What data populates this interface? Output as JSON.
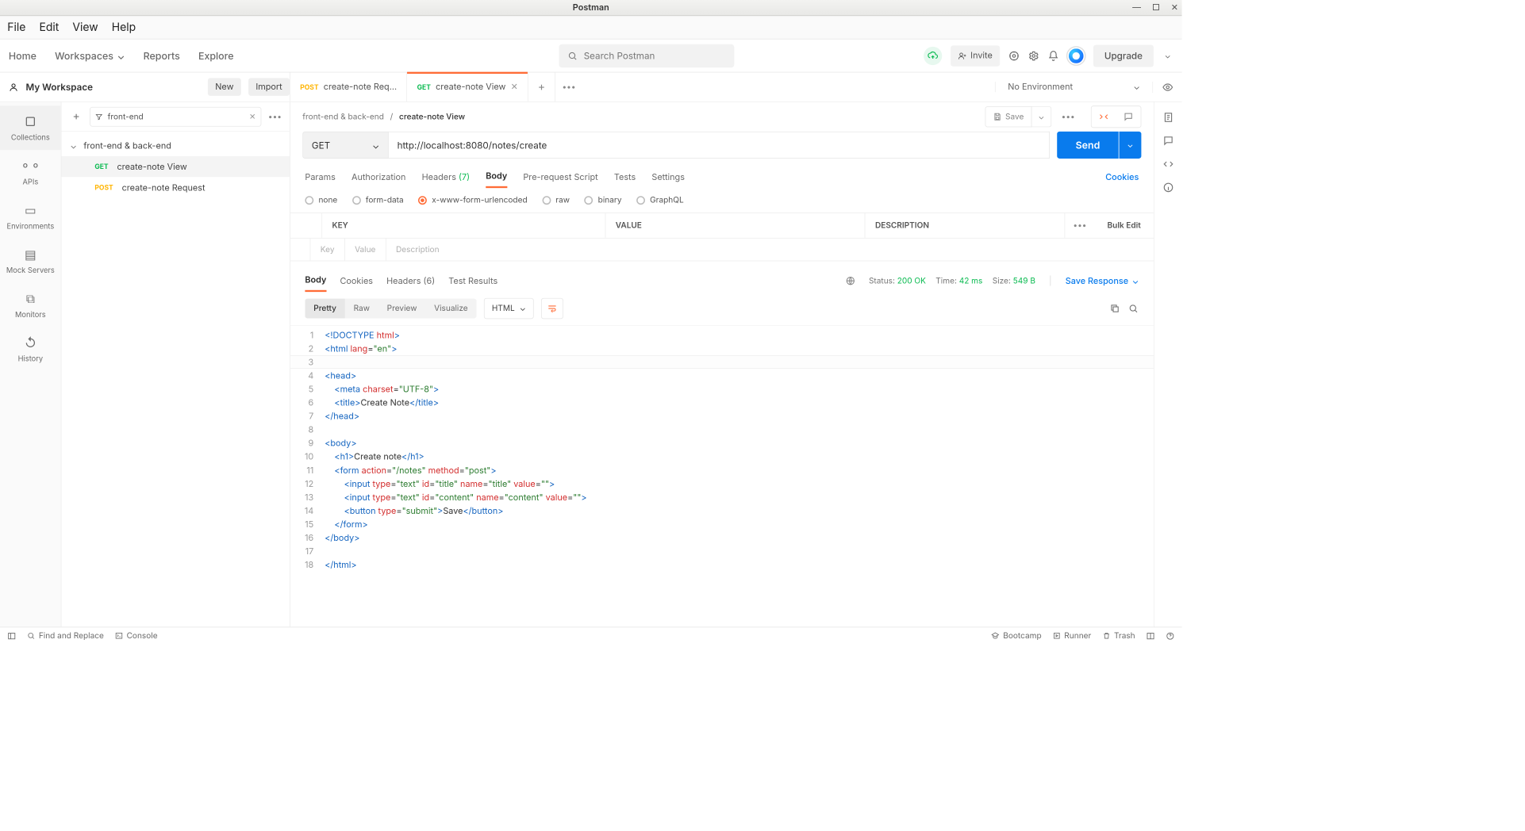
{
  "window": {
    "title": "Postman"
  },
  "menubar": [
    "File",
    "Edit",
    "View",
    "Help"
  ],
  "nav": {
    "home": "Home",
    "workspaces": "Workspaces",
    "reports": "Reports",
    "explore": "Explore",
    "search_placeholder": "Search Postman",
    "invite": "Invite",
    "upgrade": "Upgrade"
  },
  "workspace": {
    "name": "My Workspace",
    "new": "New",
    "import": "Import",
    "tabs": [
      {
        "method": "POST",
        "label": "create-note Req…",
        "active": false
      },
      {
        "method": "GET",
        "label": "create-note View",
        "active": true
      }
    ],
    "env": "No Environment"
  },
  "rail": [
    {
      "id": "collections",
      "label": "Collections"
    },
    {
      "id": "apis",
      "label": "APIs"
    },
    {
      "id": "environments",
      "label": "Environments"
    },
    {
      "id": "mock",
      "label": "Mock Servers"
    },
    {
      "id": "monitors",
      "label": "Monitors"
    },
    {
      "id": "history",
      "label": "History"
    }
  ],
  "sidebar": {
    "filter": "front-end",
    "collection": "front-end & back-end",
    "items": [
      {
        "method": "GET",
        "label": "create-note View",
        "selected": true
      },
      {
        "method": "POST",
        "label": "create-note Request",
        "selected": false
      }
    ]
  },
  "breadcrumb": {
    "parent": "front-end & back-end",
    "current": "create-note View",
    "save": "Save"
  },
  "request": {
    "method": "GET",
    "url": "http://localhost:8080/notes/create",
    "send": "Send",
    "tabs": {
      "params": "Params",
      "auth": "Authorization",
      "headers": "Headers",
      "headers_count": "(7)",
      "body": "Body",
      "prereq": "Pre-request Script",
      "tests": "Tests",
      "settings": "Settings",
      "cookies": "Cookies"
    },
    "body_types": {
      "none": "none",
      "form": "form-data",
      "xwww": "x-www-form-urlencoded",
      "raw": "raw",
      "binary": "binary",
      "graphql": "GraphQL"
    },
    "kv": {
      "key": "KEY",
      "value": "VALUE",
      "desc": "DESCRIPTION",
      "bulk": "Bulk Edit",
      "key_ph": "Key",
      "value_ph": "Value",
      "desc_ph": "Description"
    }
  },
  "response": {
    "tabs": {
      "body": "Body",
      "cookies": "Cookies",
      "headers": "Headers",
      "headers_count": "(6)",
      "tests": "Test Results"
    },
    "status_label": "Status:",
    "status_value": "200 OK",
    "time_label": "Time:",
    "time_value": "42 ms",
    "size_label": "Size:",
    "size_value": "549 B",
    "save": "Save Response",
    "views": {
      "pretty": "Pretty",
      "raw": "Raw",
      "preview": "Preview",
      "visualize": "Visualize"
    },
    "lang": "HTML",
    "code_lines": [
      {
        "n": 1,
        "html": "<span class='tag'>&lt;!DOCTYPE</span> <span class='attr'>html</span><span class='tag'>&gt;</span>"
      },
      {
        "n": 2,
        "html": "<span class='tag'>&lt;html</span> <span class='attr'>lang</span>=<span class='str'>\"en\"</span><span class='tag'>&gt;</span>"
      },
      {
        "n": 3,
        "html": ""
      },
      {
        "n": 4,
        "html": "<span class='tag'>&lt;head&gt;</span>"
      },
      {
        "n": 5,
        "html": "    <span class='tag'>&lt;meta</span> <span class='attr'>charset</span>=<span class='str'>\"UTF-8\"</span><span class='tag'>&gt;</span>"
      },
      {
        "n": 6,
        "html": "    <span class='tag'>&lt;title&gt;</span>Create Note<span class='tag'>&lt;/title&gt;</span>"
      },
      {
        "n": 7,
        "html": "<span class='tag'>&lt;/head&gt;</span>"
      },
      {
        "n": 8,
        "html": ""
      },
      {
        "n": 9,
        "html": "<span class='tag'>&lt;body&gt;</span>"
      },
      {
        "n": 10,
        "html": "    <span class='tag'>&lt;h1&gt;</span>Create note<span class='tag'>&lt;/h1&gt;</span>"
      },
      {
        "n": 11,
        "html": "    <span class='tag'>&lt;form</span> <span class='attr'>action</span>=<span class='str'>\"/notes\"</span> <span class='attr'>method</span>=<span class='str'>\"post\"</span><span class='tag'>&gt;</span>"
      },
      {
        "n": 12,
        "html": "        <span class='tag'>&lt;input</span> <span class='attr'>type</span>=<span class='str'>\"text\"</span> <span class='attr'>id</span>=<span class='str'>\"title\"</span> <span class='attr'>name</span>=<span class='str'>\"title\"</span> <span class='attr'>value</span>=<span class='str'>\"\"</span><span class='tag'>&gt;</span>"
      },
      {
        "n": 13,
        "html": "        <span class='tag'>&lt;input</span> <span class='attr'>type</span>=<span class='str'>\"text\"</span> <span class='attr'>id</span>=<span class='str'>\"content\"</span> <span class='attr'>name</span>=<span class='str'>\"content\"</span> <span class='attr'>value</span>=<span class='str'>\"\"</span><span class='tag'>&gt;</span>"
      },
      {
        "n": 14,
        "html": "        <span class='tag'>&lt;button</span> <span class='attr'>type</span>=<span class='str'>\"submit\"</span><span class='tag'>&gt;</span>Save<span class='tag'>&lt;/button&gt;</span>"
      },
      {
        "n": 15,
        "html": "    <span class='tag'>&lt;/form&gt;</span>"
      },
      {
        "n": 16,
        "html": "<span class='tag'>&lt;/body&gt;</span>"
      },
      {
        "n": 17,
        "html": ""
      },
      {
        "n": 18,
        "html": "<span class='tag'>&lt;/html&gt;</span>"
      }
    ]
  },
  "statusbar": {
    "find": "Find and Replace",
    "console": "Console",
    "bootcamp": "Bootcamp",
    "runner": "Runner",
    "trash": "Trash"
  }
}
